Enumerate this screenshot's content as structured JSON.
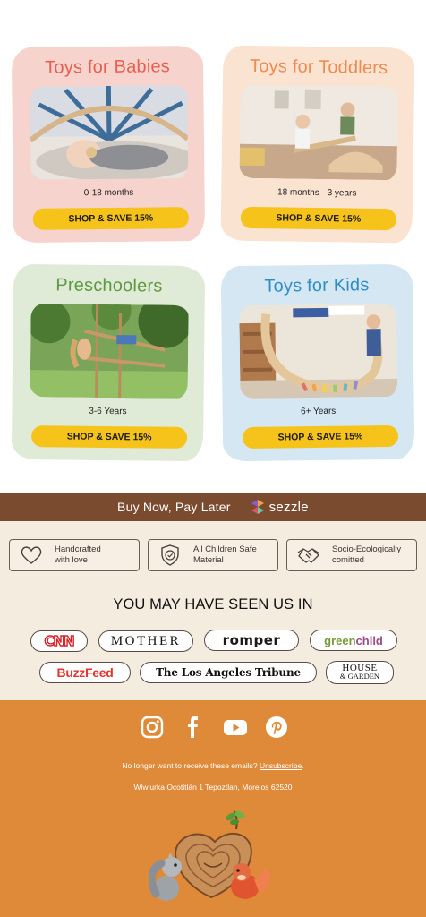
{
  "categories": [
    {
      "title": "Toys for Babies",
      "age": "0-18 months",
      "cta": "SHOP & SAVE 15%",
      "title_color": "#e85e4f"
    },
    {
      "title": "Toys for Toddlers",
      "age": "18 months - 3 years",
      "cta": "SHOP & SAVE 15%",
      "title_color": "#ee8b4f"
    },
    {
      "title": "Preschoolers",
      "age": "3-6 Years",
      "cta": "SHOP & SAVE 15%",
      "title_color": "#5d9a3f"
    },
    {
      "title": "Toys for Kids",
      "age": "6+ Years",
      "cta": "SHOP & SAVE 15%",
      "title_color": "#2d8ec6"
    }
  ],
  "bnpl": {
    "text": "Buy Now, Pay Later",
    "brand": "sezzle"
  },
  "badges": [
    {
      "line1": "Handcrafted",
      "line2": "with love",
      "icon": "heart-icon"
    },
    {
      "line1": "All Children Safe",
      "line2": "Material",
      "icon": "shield-check-icon"
    },
    {
      "line1": "Socio-Ecologically",
      "line2": "comitted",
      "icon": "handshake-icon"
    }
  ],
  "seen_title": "YOU MAY HAVE SEEN US IN",
  "press": {
    "cnn": "CNN",
    "mother": "MOTHER",
    "romper": "romper",
    "greenchild_1": "green",
    "greenchild_2": "child",
    "buzzfeed": "BuzzFeed",
    "latribune": "The Los Angeles Tribune",
    "house_1": "HOUSE",
    "house_2": "& GARDEN"
  },
  "social": [
    "instagram-icon",
    "facebook-icon",
    "youtube-icon",
    "pinterest-icon"
  ],
  "footer": {
    "unsub_text": "No longer want to receive these emails?",
    "unsub_link": "Unsubscribe",
    "unsub_after": ".",
    "address": "Wiwiurka Ocotitlán 1 Tepoztlan, Morelos 62520"
  },
  "colors": {
    "cta": "#f6c31b",
    "bnpl_bar": "#7b4b2f",
    "cream": "#f5ece0",
    "footer": "#df8a38"
  }
}
